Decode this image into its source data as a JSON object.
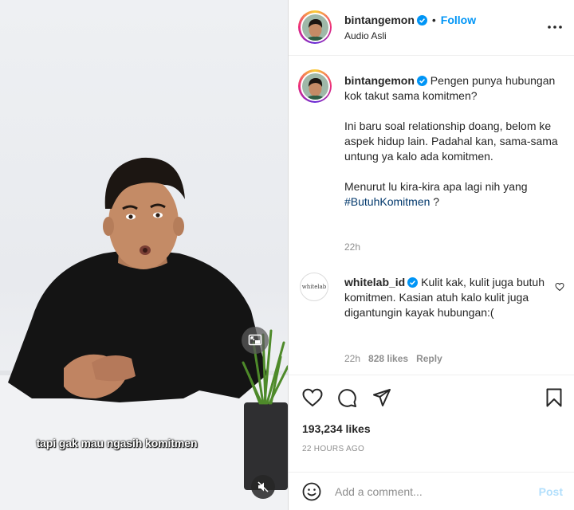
{
  "media": {
    "subtitle": "tapi gak mau ngasih komitmen",
    "pip_icon": "picture-in-picture-icon",
    "mute_icon": "speaker-muted-icon"
  },
  "header": {
    "username": "bintangemon",
    "separator": "•",
    "follow_label": "Follow",
    "audio_label": "Audio Asli",
    "more_icon": "more-options-icon"
  },
  "caption": {
    "username": "bintangemon",
    "line1": "Pengen punya hubungan kok takut sama komitmen?",
    "paragraph2": "Ini baru soal relationship doang, belom ke aspek hidup lain. Padahal kan, sama-sama untung ya kalo ada komitmen.",
    "paragraph3_prefix": "Menurut lu kira-kira apa lagi nih yang",
    "hashtag": "#ButuhKomitmen",
    "paragraph3_suffix": " ?",
    "time": "22h"
  },
  "comment": {
    "avatar_text": "whitelab",
    "username": "whitelab_id",
    "text": "Kulit kak, kulit juga butuh komitmen. Kasian atuh kalo kulit juga digantungin kayak hubungan:(",
    "time": "22h",
    "likes": "828 likes",
    "reply_label": "Reply"
  },
  "actions": {
    "like_icon": "heart-icon",
    "comment_icon": "comment-icon",
    "share_icon": "share-icon",
    "save_icon": "bookmark-icon"
  },
  "likes_count": "193,234 likes",
  "posted_time": "22 HOURS AGO",
  "add_comment": {
    "placeholder": "Add a comment...",
    "post_label": "Post",
    "emoji_icon": "emoji-icon"
  },
  "colors": {
    "accent": "#0095f6",
    "verified": "#0095f6",
    "hashtag": "#00376b",
    "muted": "#8e8e8e",
    "post_disabled": "#b2dffc"
  }
}
